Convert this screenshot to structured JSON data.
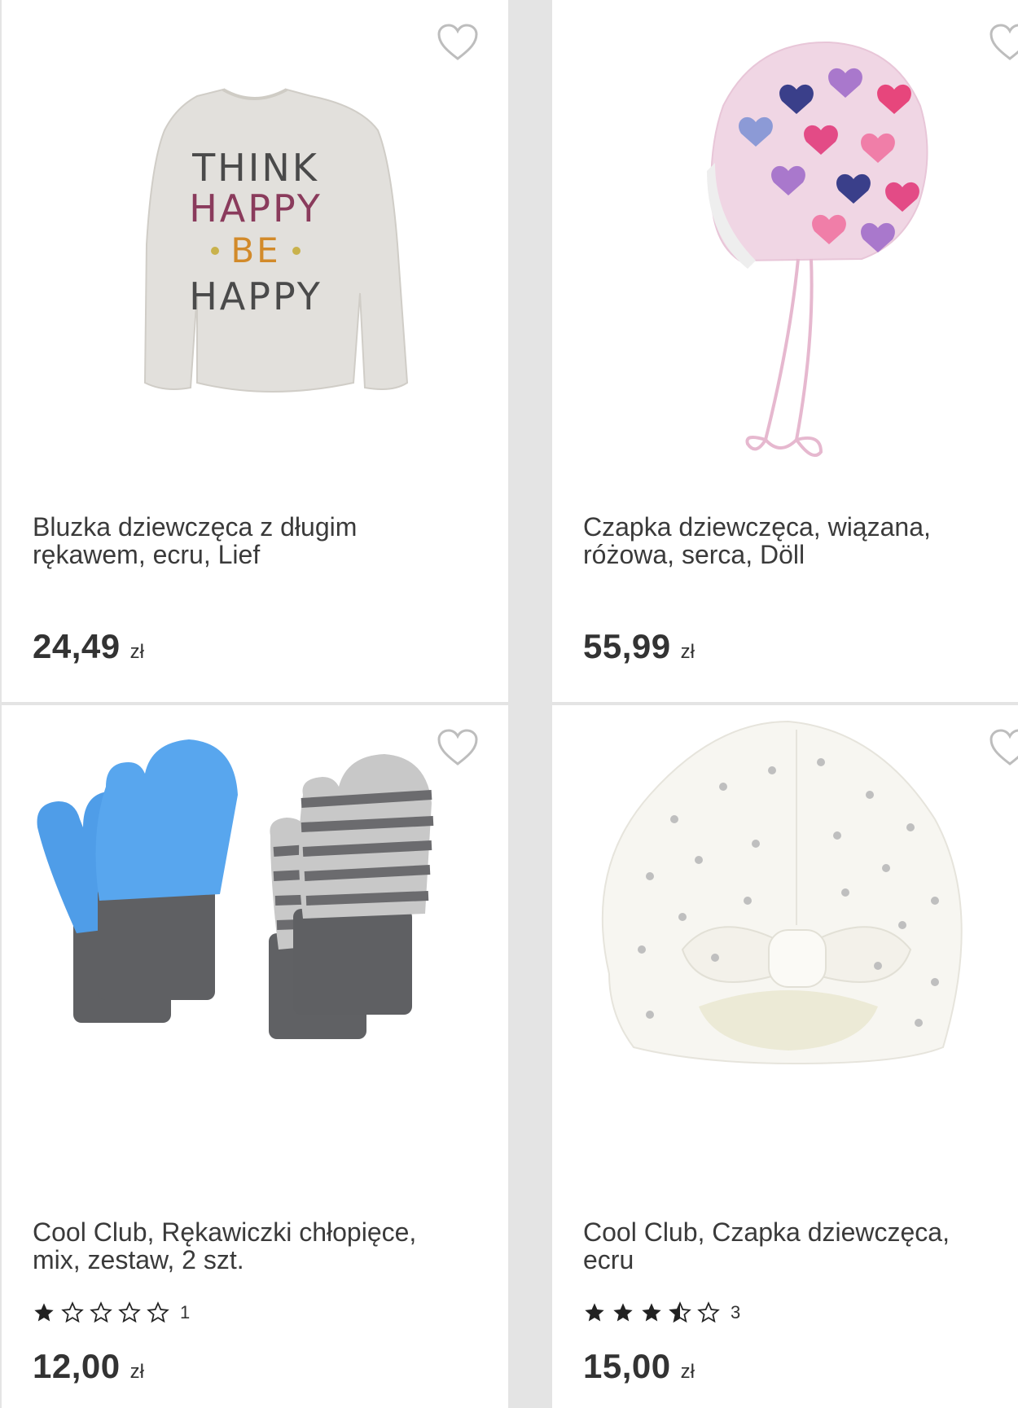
{
  "products": [
    {
      "title": "Bluzka dziewczęca z długim rękawem, ecru, Lief",
      "price": "24,49",
      "currency": "zł",
      "rating": null,
      "rating_count": null,
      "icon": "longsleeve-shirt-image",
      "print_text": [
        "THINK",
        "HAPPY",
        "BE",
        "HAPPY"
      ]
    },
    {
      "title": "Czapka dziewczęca, wiązana, różowa, serca, Döll",
      "price": "55,99",
      "currency": "zł",
      "rating": null,
      "rating_count": null,
      "icon": "knit-hat-hearts-image"
    },
    {
      "title": "Cool Club, Rękawiczki chłopięce, mix, zestaw, 2 szt.",
      "price": "12,00",
      "currency": "zł",
      "rating": 1,
      "rating_count": "1",
      "icon": "mittens-image"
    },
    {
      "title": "Cool Club, Czapka dziewczęca, ecru",
      "price": "15,00",
      "currency": "zł",
      "rating": 3.5,
      "rating_count": "3",
      "icon": "turban-hat-image"
    }
  ],
  "colors": {
    "text": "#333333",
    "star": "#222222",
    "heart_outline": "#bdbdbd",
    "background": "#e4e4e4"
  }
}
